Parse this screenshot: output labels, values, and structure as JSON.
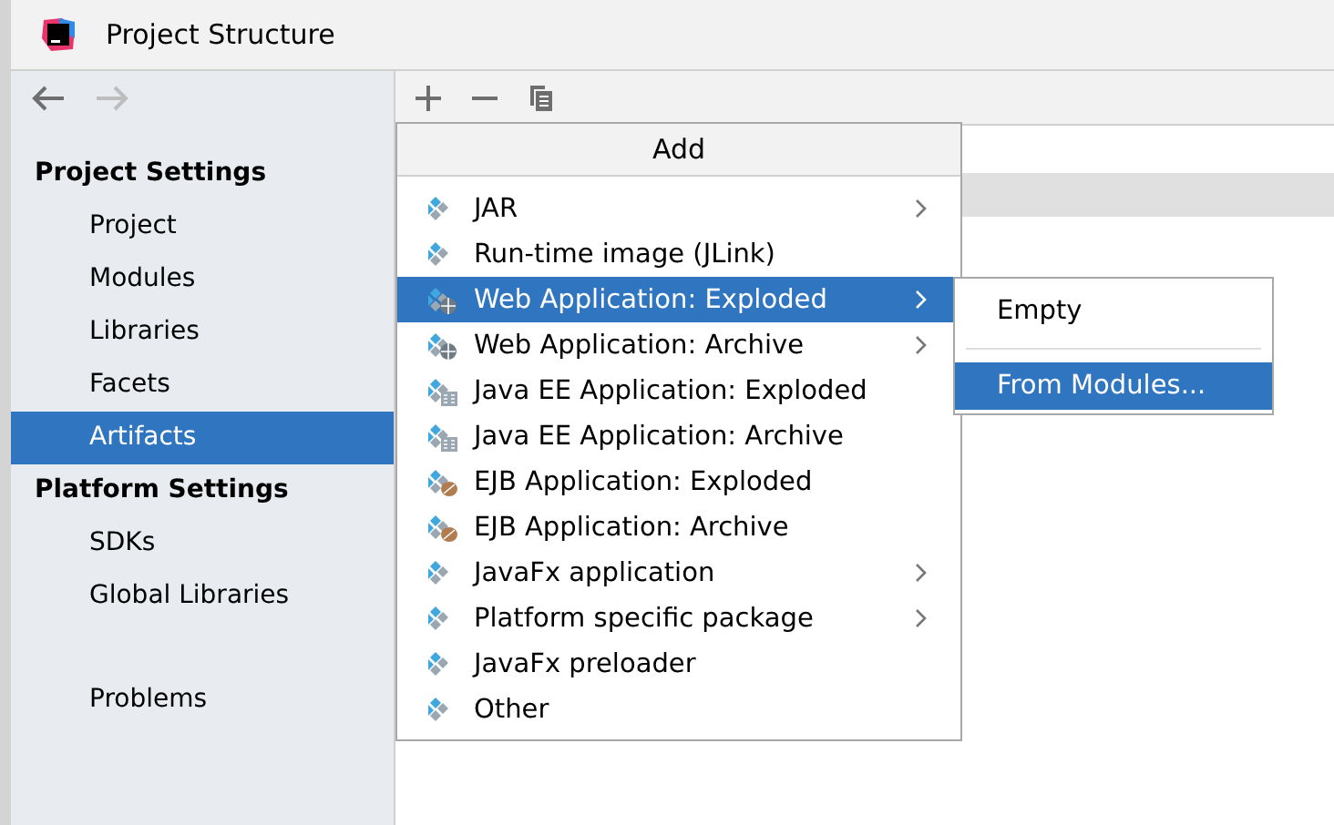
{
  "window": {
    "title": "Project Structure"
  },
  "sidebar": {
    "sections": [
      {
        "title": "Project Settings",
        "items": [
          {
            "label": "Project",
            "selected": false
          },
          {
            "label": "Modules",
            "selected": false
          },
          {
            "label": "Libraries",
            "selected": false
          },
          {
            "label": "Facets",
            "selected": false
          },
          {
            "label": "Artifacts",
            "selected": true
          }
        ]
      },
      {
        "title": "Platform Settings",
        "items": [
          {
            "label": "SDKs",
            "selected": false
          },
          {
            "label": "Global Libraries",
            "selected": false
          }
        ]
      }
    ],
    "extra_items": [
      {
        "label": "Problems",
        "selected": false
      }
    ]
  },
  "add_menu": {
    "title": "Add",
    "items": [
      {
        "label": "JAR",
        "kind": "plain",
        "submenu": true,
        "selected": false
      },
      {
        "label": "Run-time image (JLink)",
        "kind": "plain",
        "submenu": false,
        "selected": false
      },
      {
        "label": "Web Application: Exploded",
        "kind": "web",
        "submenu": true,
        "selected": true
      },
      {
        "label": "Web Application: Archive",
        "kind": "web",
        "submenu": true,
        "selected": false
      },
      {
        "label": "Java EE Application: Exploded",
        "kind": "javaee",
        "submenu": false,
        "selected": false
      },
      {
        "label": "Java EE Application: Archive",
        "kind": "javaee",
        "submenu": false,
        "selected": false
      },
      {
        "label": "EJB Application: Exploded",
        "kind": "ejb",
        "submenu": false,
        "selected": false
      },
      {
        "label": "EJB Application: Archive",
        "kind": "ejb",
        "submenu": false,
        "selected": false
      },
      {
        "label": "JavaFx application",
        "kind": "plain",
        "submenu": true,
        "selected": false
      },
      {
        "label": "Platform specific package",
        "kind": "plain",
        "submenu": true,
        "selected": false
      },
      {
        "label": "JavaFx preloader",
        "kind": "plain",
        "submenu": false,
        "selected": false
      },
      {
        "label": "Other",
        "kind": "plain",
        "submenu": false,
        "selected": false
      }
    ]
  },
  "submenu": {
    "items": [
      {
        "label": "Empty",
        "selected": false
      },
      {
        "label": "From Modules...",
        "selected": true
      }
    ]
  }
}
